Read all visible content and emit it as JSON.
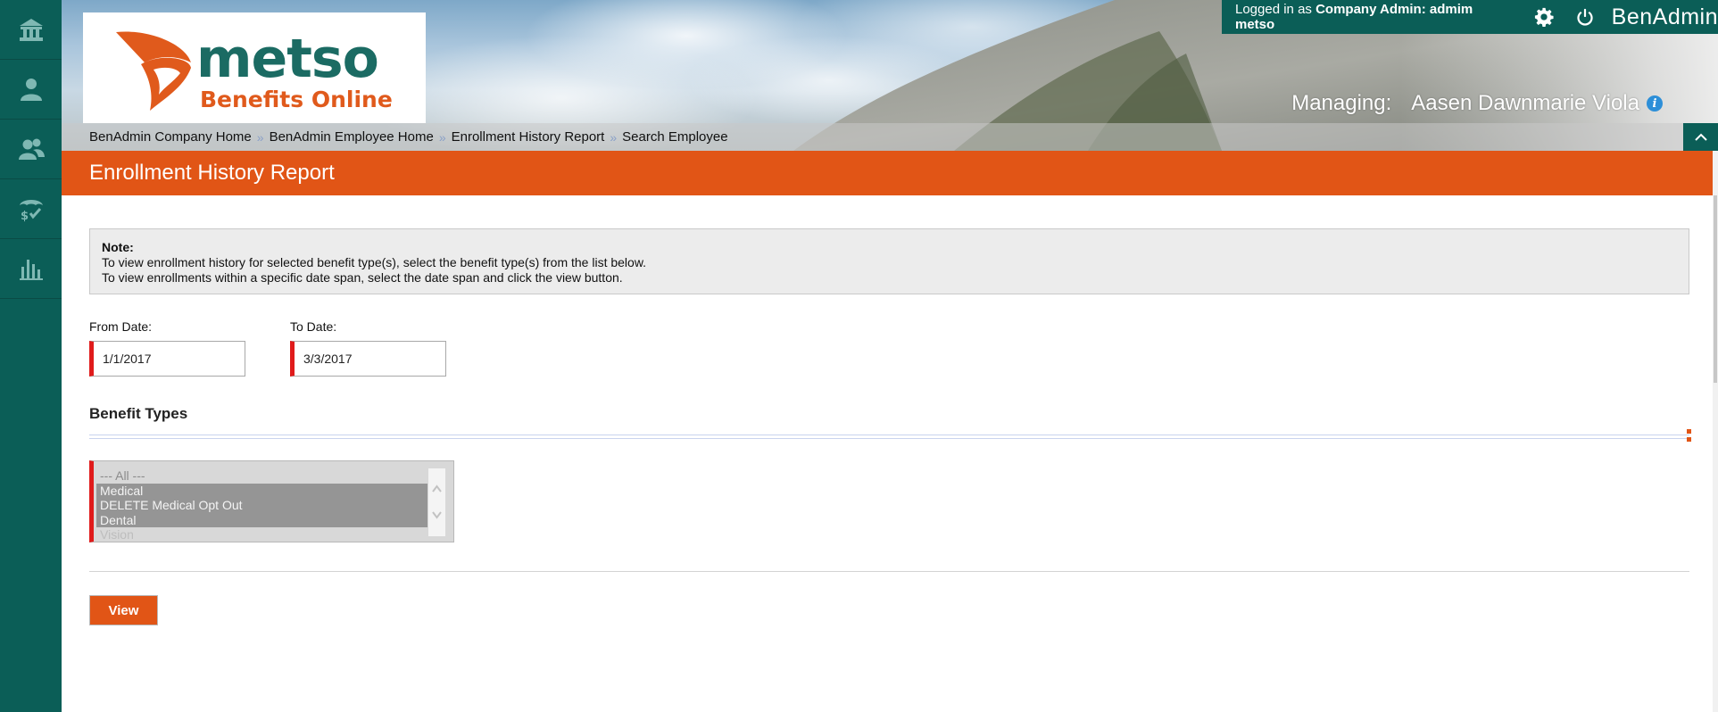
{
  "sidebar": {
    "items": [
      {
        "icon": "home-icon"
      },
      {
        "icon": "user-icon"
      },
      {
        "icon": "users-icon"
      },
      {
        "icon": "benefits-umbrella-icon"
      },
      {
        "icon": "bar-chart-icon"
      }
    ]
  },
  "header": {
    "logo_name": "metso",
    "logo_tagline": "Benefits Online",
    "logged_in_prefix": "Logged in as",
    "logged_in_role": "Company Admin:",
    "logged_in_user": "admim metso",
    "settings_icon": "gear-icon",
    "logout_icon": "power-icon",
    "app_name": "BenAdmin",
    "managing_label": "Managing:",
    "managing_name": "Aasen Dawnmarie Viola",
    "info_icon": "info-icon"
  },
  "breadcrumb": [
    "BenAdmin Company Home",
    "BenAdmin Employee Home",
    "Enrollment History Report",
    "Search Employee"
  ],
  "page_title": "Enrollment History Report",
  "note": {
    "title": "Note:",
    "line1": "To view enrollment history for selected benefit type(s), select the benefit type(s) from the list below.",
    "line2": "To view enrollments within a specific date span, select the date span and click the view button."
  },
  "from_date": {
    "label": "From Date:",
    "value": "1/1/2017"
  },
  "to_date": {
    "label": "To Date:",
    "value": "3/3/2017"
  },
  "benefit_types": {
    "heading": "Benefit Types",
    "options": [
      "--- All ---",
      "Medical",
      "DELETE Medical Opt Out",
      "Dental",
      "Vision"
    ]
  },
  "view_button": "View",
  "colors": {
    "sidebar": "#0b5e57",
    "accent_orange": "#e15516",
    "required_marker": "#e01b1b",
    "logo_green": "#1b6b63"
  }
}
